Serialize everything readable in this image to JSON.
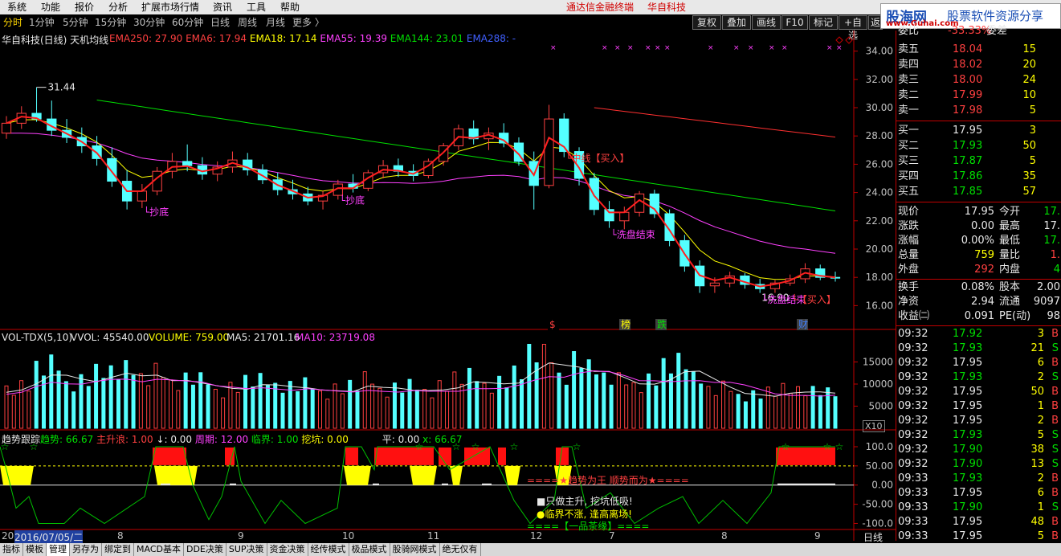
{
  "menu": {
    "items": [
      "系统",
      "功能",
      "报价",
      "分析",
      "扩展市场行情",
      "资讯",
      "工具",
      "帮助"
    ],
    "center": "通达信金融终端",
    "stock": "华自科技"
  },
  "periods": [
    "分时",
    "1分钟",
    "5分钟",
    "15分钟",
    "30分钟",
    "60分钟",
    "日线",
    "周线",
    "月线",
    "更多 〉"
  ],
  "toolbar": [
    "复权",
    "叠加",
    "画线",
    "F10",
    "标记",
    "+自选",
    "返"
  ],
  "logo": {
    "big": "股海网",
    "small": "股票软件资源分享",
    "url": "www.Guhai.com"
  },
  "main_chart": {
    "title": "华自科技(日线) 天机均线",
    "ema": [
      {
        "label": "EMA250: 27.90",
        "color": "#ff4040"
      },
      {
        "label": "EMA6: 17.94",
        "color": "#ff4040"
      },
      {
        "label": "EMA18: 17.14",
        "color": "#ffff00"
      },
      {
        "label": "EMA55: 19.39",
        "color": "#ff40ff"
      },
      {
        "label": "EMA144: 23.01",
        "color": "#00e000"
      },
      {
        "label": "EMA288: -",
        "color": "#4060ff"
      }
    ],
    "y_ticks": [
      "34.00",
      "32.00",
      "30.00",
      "28.00",
      "26.00",
      "24.00",
      "22.00",
      "20.00",
      "18.00",
      "16.00"
    ],
    "high_label": "31.44",
    "low_label": "16.90",
    "signals": [
      "抄底",
      "抄底",
      "洗盘结束",
      "中线【买入】",
      "洗盘结束",
      "【买入】"
    ],
    "markers": [
      "$",
      "榜",
      "跌",
      "财"
    ]
  },
  "volume": {
    "title": "VOL-TDX(5,10)",
    "vvol": "VVOL: 45540.00",
    "volume": "VOLUME: 759.00",
    "ma5": "MA5: 21701.16",
    "ma10": "MA10: 23719.08",
    "y_ticks": [
      "15000",
      "10000",
      "5000"
    ],
    "unit": "X10"
  },
  "trend": {
    "title": "趋势跟踪",
    "items": [
      {
        "label": "趋势: 66.67",
        "color": "#00e000"
      },
      {
        "label": "主升浪: 1.00",
        "color": "#ff4040"
      },
      {
        "label": "↓: 0.00",
        "color": "#e8e8e8"
      },
      {
        "label": "周期: 12.00",
        "color": "#ff40ff"
      },
      {
        "label": "临界: 1.00",
        "color": "#00e000"
      },
      {
        "label": "挖坑: 0.00",
        "color": "#ffff00"
      },
      {
        "label": "平: 0.00",
        "color": "#e8e8e8"
      },
      {
        "label": "x: 66.67",
        "color": "#00e000"
      }
    ],
    "y_ticks": [
      "100.0",
      "50.00",
      "0.00",
      "-50.00",
      "-100.0"
    ],
    "banner": "====★趋势为王 顺势而为★====",
    "tips": [
      "■只做主升, 挖坑低吸!",
      "●临界不涨, 逢高离场!",
      "====【一品茶缘】===="
    ]
  },
  "date_axis": {
    "labels": [
      "20",
      "2016/07/05/二",
      "8",
      "9",
      "10",
      "11",
      "12",
      "7",
      "8",
      "9"
    ],
    "mode": "日线"
  },
  "quote": {
    "top": {
      "label": "委比",
      "value": "-33.33%",
      "label2": "委差",
      "value2": "..."
    },
    "asks": [
      {
        "label": "卖五",
        "price": "18.04",
        "vol": "15"
      },
      {
        "label": "卖四",
        "price": "18.02",
        "vol": "20"
      },
      {
        "label": "卖三",
        "price": "18.00",
        "vol": "24"
      },
      {
        "label": "卖二",
        "price": "17.99",
        "vol": "10"
      },
      {
        "label": "卖一",
        "price": "17.98",
        "vol": "5"
      }
    ],
    "bids": [
      {
        "label": "买一",
        "price": "17.95",
        "vol": "3"
      },
      {
        "label": "买二",
        "price": "17.93",
        "vol": "50"
      },
      {
        "label": "买三",
        "price": "17.87",
        "vol": "5"
      },
      {
        "label": "买四",
        "price": "17.86",
        "vol": "35"
      },
      {
        "label": "买五",
        "price": "17.85",
        "vol": "57"
      }
    ],
    "stats": [
      {
        "l1": "现价",
        "v1": "17.95",
        "c1": "#e8e8e8",
        "l2": "今开",
        "v2": "17.",
        "c2": "#00e000"
      },
      {
        "l1": "涨跌",
        "v1": "0.00",
        "c1": "#e8e8e8",
        "l2": "最高",
        "v2": "17.",
        "c2": "#e8e8e8"
      },
      {
        "l1": "涨幅",
        "v1": "0.00%",
        "c1": "#e8e8e8",
        "l2": "最低",
        "v2": "17.",
        "c2": "#00e000"
      },
      {
        "l1": "总量",
        "v1": "759",
        "c1": "#ffff00",
        "l2": "量比",
        "v2": "1.",
        "c2": "#ff4040"
      },
      {
        "l1": "外盘",
        "v1": "292",
        "c1": "#ff4040",
        "l2": "内盘",
        "v2": "4",
        "c2": "#00e000"
      }
    ],
    "stats2": [
      {
        "l1": "换手",
        "v1": "0.08%",
        "l2": "股本",
        "v2": "2.00"
      },
      {
        "l1": "净资",
        "v1": "2.94",
        "l2": "流通",
        "v2": "9097"
      },
      {
        "l1": "收益㈡",
        "v1": "0.091",
        "l2": "PE(动)",
        "v2": "98"
      }
    ],
    "ticks": [
      {
        "t": "09:32",
        "p": "17.92",
        "v": "3",
        "s": "B"
      },
      {
        "t": "09:32",
        "p": "17.93",
        "v": "21",
        "s": "S"
      },
      {
        "t": "09:32",
        "p": "17.95",
        "v": "6",
        "s": "B"
      },
      {
        "t": "09:32",
        "p": "17.93",
        "v": "2",
        "s": "S"
      },
      {
        "t": "09:32",
        "p": "17.95",
        "v": "50",
        "s": "B"
      },
      {
        "t": "09:32",
        "p": "17.95",
        "v": "1",
        "s": "B"
      },
      {
        "t": "09:32",
        "p": "17.95",
        "v": "2",
        "s": "B"
      },
      {
        "t": "09:32",
        "p": "17.93",
        "v": "5",
        "s": "S"
      },
      {
        "t": "09:32",
        "p": "17.90",
        "v": "38",
        "s": "S"
      },
      {
        "t": "09:32",
        "p": "17.90",
        "v": "13",
        "s": "S"
      },
      {
        "t": "09:33",
        "p": "17.93",
        "v": "2",
        "s": "B"
      },
      {
        "t": "09:33",
        "p": "17.95",
        "v": "6",
        "s": "B"
      },
      {
        "t": "09:33",
        "p": "17.90",
        "v": "1",
        "s": "S"
      },
      {
        "t": "09:33",
        "p": "17.95",
        "v": "48",
        "s": "B"
      },
      {
        "t": "09:33",
        "p": "17.95",
        "v": "5",
        "s": "B"
      }
    ]
  },
  "bottom_tabs": [
    "指标",
    "模板",
    "管理",
    "另存为",
    "绑定到",
    "MACD基本",
    "DDE决策",
    "SUP决策",
    "资金决策",
    "经传模式",
    "极品模式",
    "股骑网模式",
    "绝无仅有"
  ],
  "chart_data": {
    "type": "candlestick",
    "ohlc": [
      [
        28.2,
        29.4,
        27.8,
        28.9
      ],
      [
        28.9,
        30.1,
        28.5,
        29.6
      ],
      [
        29.6,
        31.44,
        29.0,
        29.2
      ],
      [
        29.2,
        30.5,
        28.0,
        28.4
      ],
      [
        28.4,
        29.2,
        27.5,
        27.9
      ],
      [
        27.9,
        28.6,
        26.8,
        27.3
      ],
      [
        27.3,
        28.0,
        25.9,
        26.4
      ],
      [
        26.4,
        27.2,
        24.4,
        24.8
      ],
      [
        24.8,
        25.6,
        22.8,
        23.4
      ],
      [
        23.4,
        24.6,
        22.9,
        24.1
      ],
      [
        24.1,
        25.8,
        23.8,
        25.5
      ],
      [
        25.5,
        26.8,
        25.0,
        26.2
      ],
      [
        26.2,
        27.4,
        25.5,
        25.9
      ],
      [
        25.9,
        26.5,
        24.9,
        25.3
      ],
      [
        25.3,
        26.2,
        24.8,
        25.8
      ],
      [
        25.8,
        26.9,
        25.4,
        26.3
      ],
      [
        26.3,
        26.8,
        25.2,
        25.6
      ],
      [
        25.6,
        26.0,
        24.6,
        24.9
      ],
      [
        24.9,
        25.4,
        23.8,
        24.2
      ],
      [
        24.2,
        24.9,
        23.5,
        23.9
      ],
      [
        23.9,
        24.4,
        23.1,
        23.4
      ],
      [
        23.4,
        24.1,
        22.8,
        23.8
      ],
      [
        23.8,
        24.9,
        23.5,
        24.6
      ],
      [
        24.6,
        25.3,
        24.0,
        24.3
      ],
      [
        24.3,
        25.6,
        24.1,
        25.4
      ],
      [
        25.4,
        26.3,
        25.0,
        25.9
      ],
      [
        25.9,
        26.4,
        25.1,
        25.5
      ],
      [
        25.5,
        26.0,
        24.8,
        25.2
      ],
      [
        25.2,
        26.4,
        25.0,
        26.2
      ],
      [
        26.2,
        27.5,
        25.9,
        27.3
      ],
      [
        27.3,
        28.8,
        27.0,
        28.5
      ],
      [
        28.5,
        29.1,
        27.4,
        27.8
      ],
      [
        27.8,
        28.6,
        27.0,
        28.2
      ],
      [
        28.2,
        28.9,
        27.2,
        27.5
      ],
      [
        27.5,
        27.9,
        25.9,
        26.2
      ],
      [
        26.2,
        26.9,
        22.8,
        24.5
      ],
      [
        24.5,
        30.2,
        24.3,
        29.2
      ],
      [
        29.2,
        29.6,
        26.5,
        26.9
      ],
      [
        26.9,
        27.2,
        24.5,
        25.0
      ],
      [
        25.0,
        25.4,
        22.4,
        22.8
      ],
      [
        22.8,
        23.4,
        21.5,
        22.0
      ],
      [
        22.0,
        23.0,
        21.4,
        22.6
      ],
      [
        22.6,
        24.1,
        22.3,
        23.9
      ],
      [
        23.9,
        24.2,
        22.2,
        22.5
      ],
      [
        22.5,
        22.8,
        20.2,
        20.6
      ],
      [
        20.6,
        21.0,
        18.4,
        18.8
      ],
      [
        18.8,
        19.2,
        16.9,
        17.4
      ],
      [
        17.4,
        18.0,
        16.9,
        17.6
      ],
      [
        17.6,
        18.4,
        17.3,
        18.1
      ],
      [
        18.1,
        18.3,
        17.2,
        17.5
      ],
      [
        17.5,
        17.9,
        16.9,
        17.2
      ],
      [
        17.2,
        17.8,
        16.9,
        17.6
      ],
      [
        17.6,
        18.2,
        17.4,
        17.9
      ],
      [
        17.9,
        19.0,
        17.6,
        18.6
      ],
      [
        18.6,
        18.9,
        17.8,
        18.0
      ],
      [
        18.0,
        18.4,
        17.7,
        17.95
      ]
    ],
    "x": "daily",
    "ylim": [
      15.0,
      35.0
    ]
  }
}
